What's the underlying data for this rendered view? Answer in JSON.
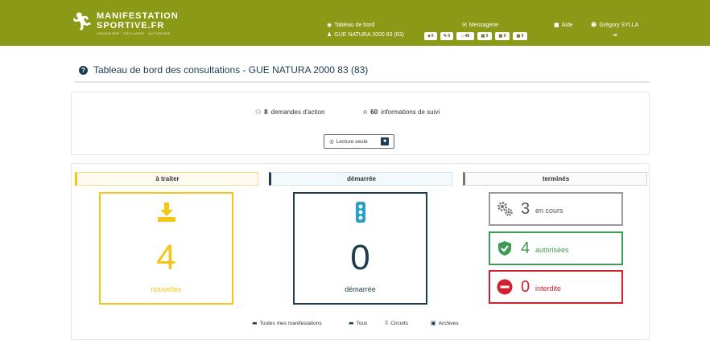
{
  "colors": {
    "topbar": "#8a9a16",
    "traiter": "#f5c518",
    "demarree": "#1c3d4f",
    "autorisees": "#3f9a55",
    "interdite": "#d0212e",
    "encours": "#9a9a9a"
  },
  "logo": {
    "line1": "MANIFESTATION",
    "line2": "SPORTIVE.FR",
    "line3": "ORGANISER · DÉCLARER · AUTORISER",
    "icon": "runner-icon"
  },
  "nav": {
    "dashboard": {
      "label": "Tableau de bord",
      "icon": "dashboard-icon"
    },
    "dashboard_sub": {
      "label": "GUE NATURA 2000 83 (83)",
      "icon": "user-shield-icon"
    },
    "messages": {
      "label": "Messagerie",
      "icon": "envelope-icon"
    },
    "help": {
      "label": "Aide",
      "icon": "book-icon"
    },
    "user": {
      "label": "Grégory SYLLA",
      "icon": "user-icon"
    },
    "logout": {
      "icon": "logout-icon"
    },
    "badges": [
      "■ 0",
      "✎ 0",
      "⌂ 48",
      "▤ 0",
      "▤ 0",
      "▤ 0"
    ]
  },
  "page": {
    "title": "Tableau de bord des consultations - GUE NATURA 2000 83 (83)"
  },
  "summary": {
    "actions_count": "8",
    "actions_label": "demandes d'action",
    "infos_count": "60",
    "infos_label": "informations de suivi",
    "readonly_label": "Lecture seule"
  },
  "columns": {
    "traiter": "à traiter",
    "demarree": "démarrée",
    "termines": "terminés"
  },
  "cards": {
    "traiter": {
      "value": "4",
      "label": "nouvelles"
    },
    "demarree": {
      "value": "0",
      "label": "démarrée"
    },
    "encours": {
      "value": "3",
      "label": "en cours"
    },
    "autorisees": {
      "value": "4",
      "label": "autorisées"
    },
    "interdite": {
      "value": "0",
      "label": "interdite"
    }
  },
  "filters": {
    "all_events": "Toutes mes manifestations",
    "all": "Tous",
    "circuits": "Circuits",
    "archives": "Archives"
  }
}
